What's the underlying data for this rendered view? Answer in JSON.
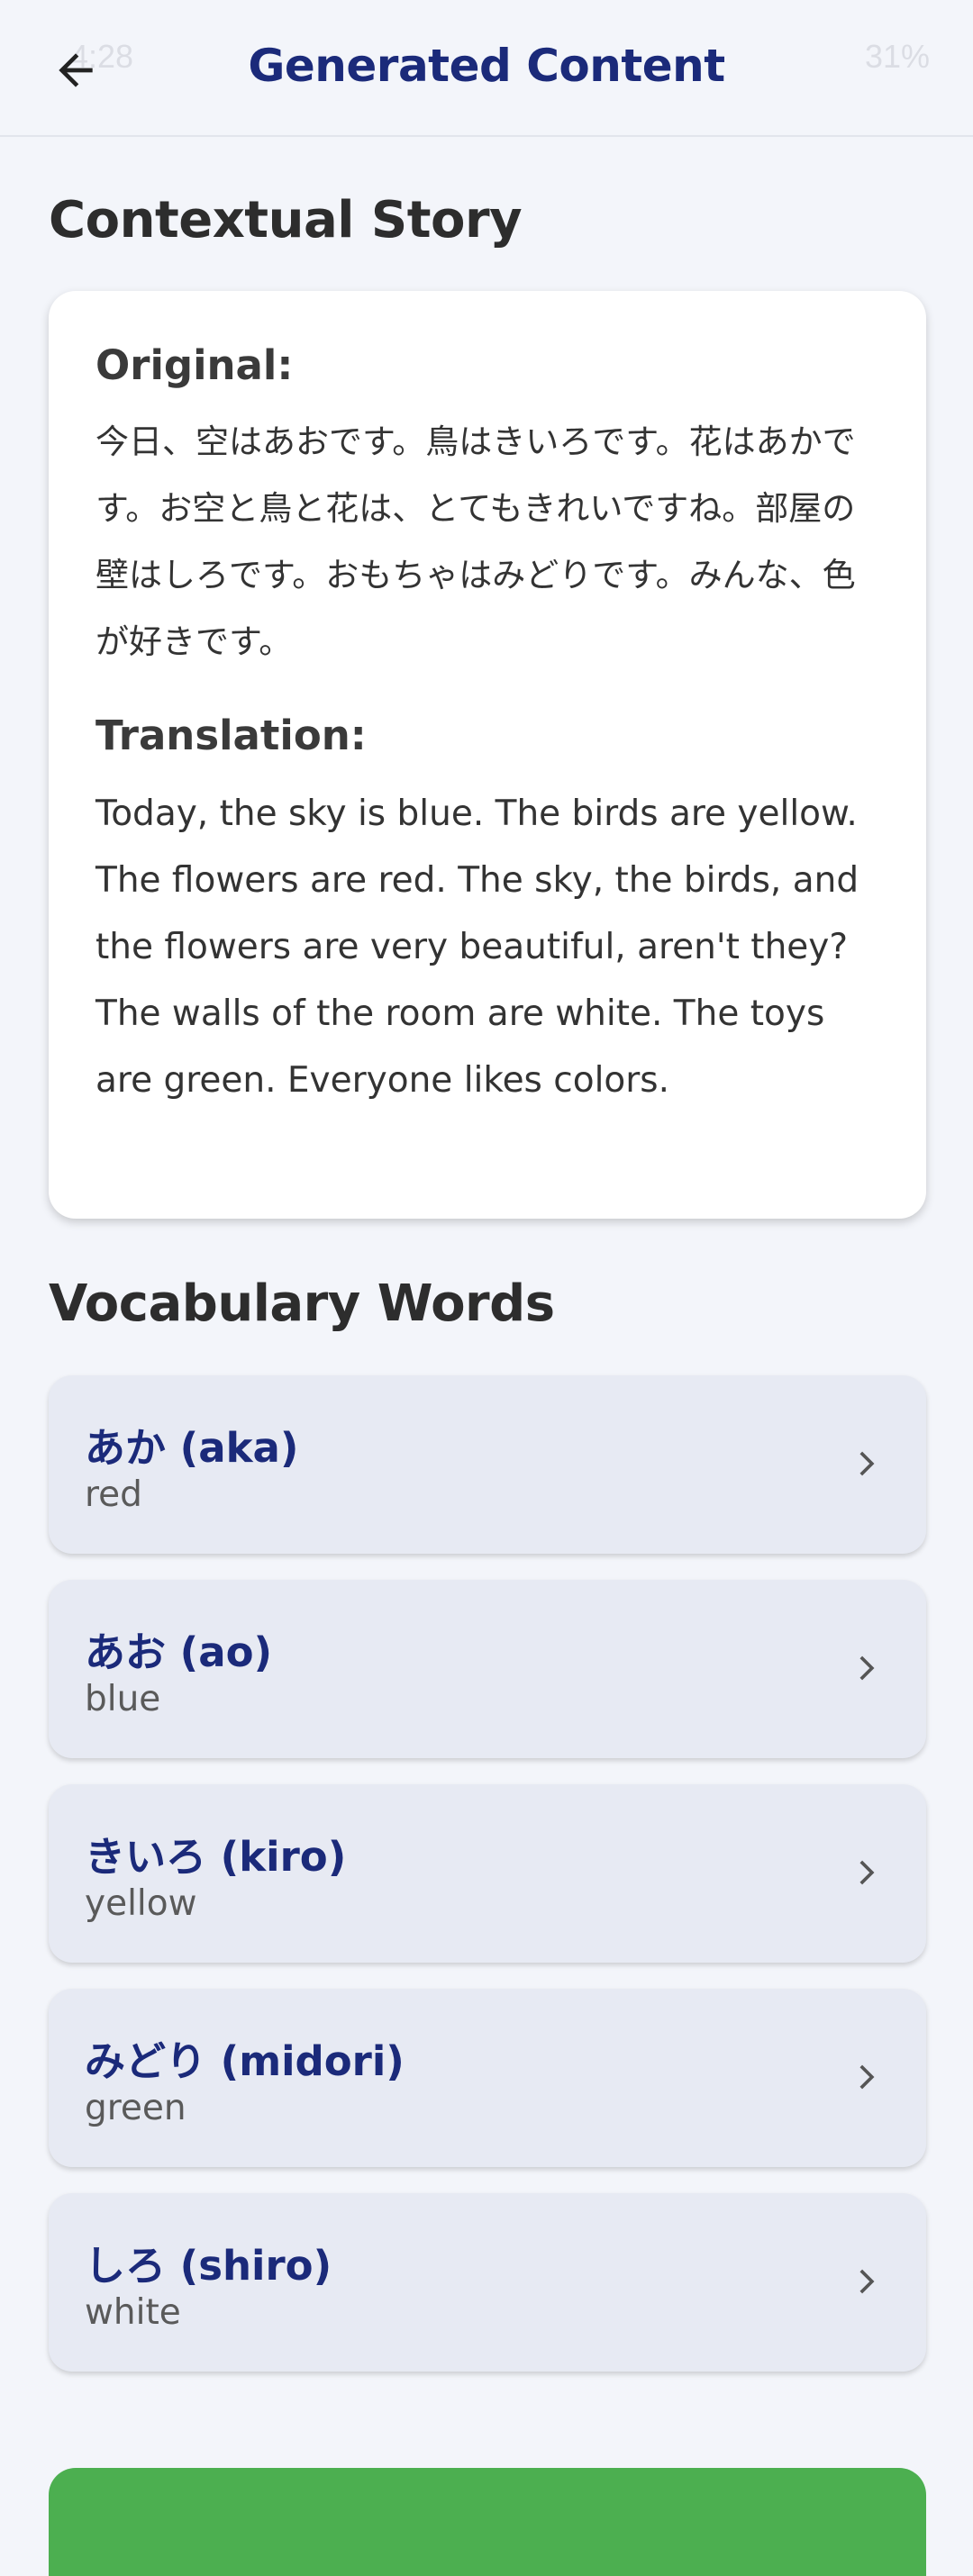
{
  "status_bar": {
    "time": "4:28",
    "battery": "31%"
  },
  "header": {
    "title": "Generated Content",
    "back_icon": "arrow-left-icon"
  },
  "story": {
    "section_title": "Contextual Story",
    "original_label": "Original:",
    "original_text": "今日、空はあおです。鳥はきいろです。花はあかです。お空と鳥と花は、とてもきれいですね。部屋の壁はしろです。おもちゃはみどりです。みんな、色が好きです。",
    "translation_label": "Translation:",
    "translation_text": "Today, the sky is blue. The birds are yellow. The flowers are red. The sky, the birds, and the flowers are very beautiful, aren't they? The walls of the room are white. The toys are green. Everyone likes colors."
  },
  "vocabulary": {
    "section_title": "Vocabulary Words",
    "items": [
      {
        "term": "あか (aka)",
        "meaning": "red"
      },
      {
        "term": "あお (ao)",
        "meaning": "blue"
      },
      {
        "term": "きいろ (kiro)",
        "meaning": "yellow"
      },
      {
        "term": "みどり (midori)",
        "meaning": "green"
      },
      {
        "term": "しろ (shiro)",
        "meaning": "white"
      }
    ],
    "chevron_icon": "chevron-right-icon"
  },
  "colors": {
    "accent": "#1b2a7a",
    "background": "#f3f5fa",
    "card": "#ffffff",
    "vocab_card": "#e7eaf3",
    "action": "#4caf50"
  }
}
